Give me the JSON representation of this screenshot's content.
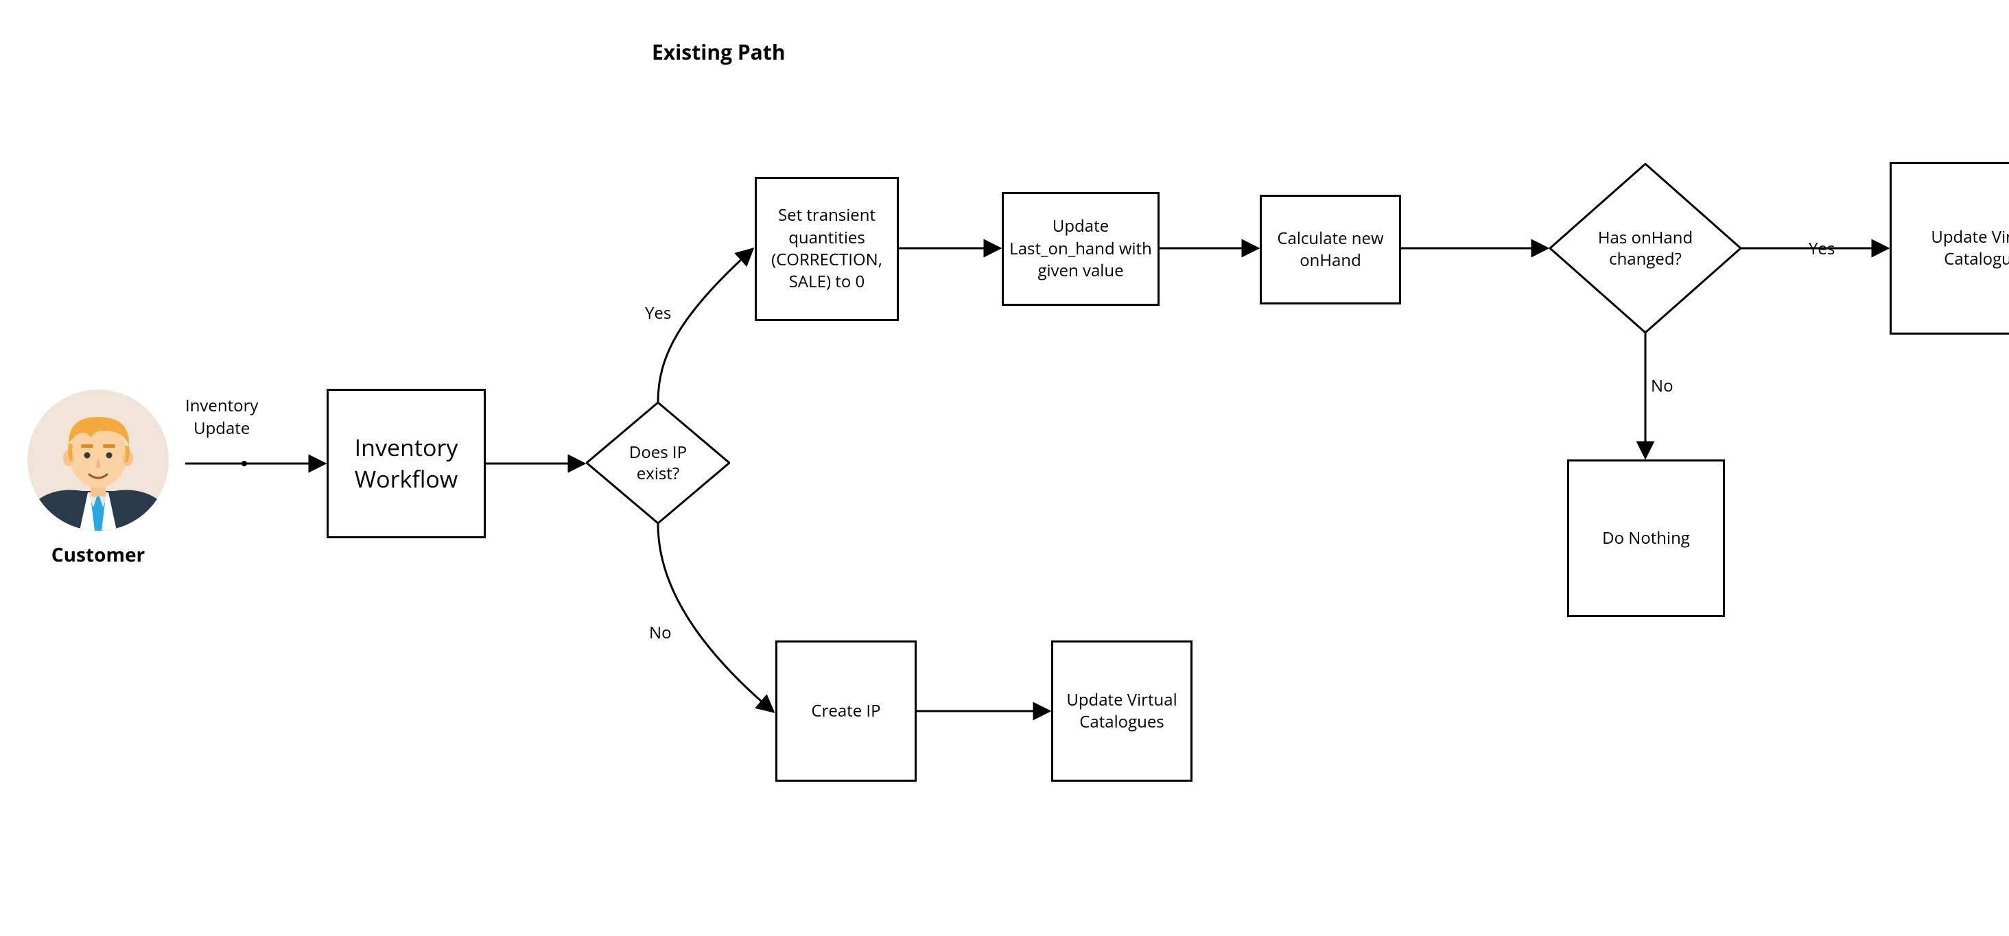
{
  "title": "Existing Path",
  "actor": {
    "name": "Customer"
  },
  "edges": {
    "inventory_update": "Inventory\nUpdate",
    "yes1": "Yes",
    "no1": "No",
    "yes2": "Yes",
    "no2": "No"
  },
  "nodes": {
    "inventory_workflow": "Inventory Workflow",
    "does_ip_exist": "Does IP exist?",
    "set_transient": "Set transient quantities (CORRECTION, SALE) to 0",
    "update_last_on_hand": "Update Last_on_hand with given value",
    "calculate_new_onhand": "Calculate new onHand",
    "has_onhand_changed": "Has onHand changed?",
    "update_virtual_catalogues_top": "Update Virtual Catalogues",
    "do_nothing": "Do Nothing",
    "create_ip": "Create IP",
    "update_virtual_catalogues_bottom": "Update Virtual Catalogues"
  }
}
